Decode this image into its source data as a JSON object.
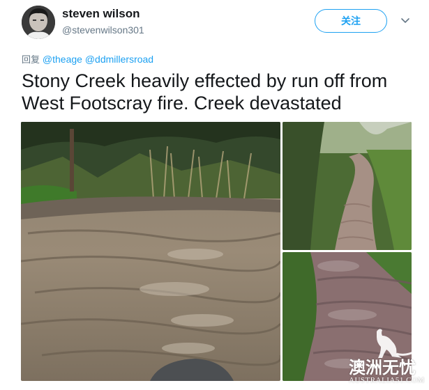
{
  "user": {
    "display_name": "steven wilson",
    "handle": "@stevenwilson301",
    "avatar_icon": "user-avatar"
  },
  "actions": {
    "follow_label": "关注",
    "menu_icon": "chevron-down-icon"
  },
  "reply": {
    "prefix": "回复",
    "mentions": [
      "@theage",
      "@ddmillersroad"
    ]
  },
  "tweet": {
    "text": "Stony Creek heavily effected by run off from West Footscray fire. Creek devastated"
  },
  "media": {
    "photos": [
      "photo-creek-wide",
      "photo-creek-upstream",
      "photo-creek-bank"
    ]
  },
  "watermark": {
    "main": "澳洲无忧",
    "url": "AUSTRALIA51.COM"
  },
  "colors": {
    "accent": "#1da1f2",
    "text": "#14171a",
    "muted": "#657786"
  }
}
